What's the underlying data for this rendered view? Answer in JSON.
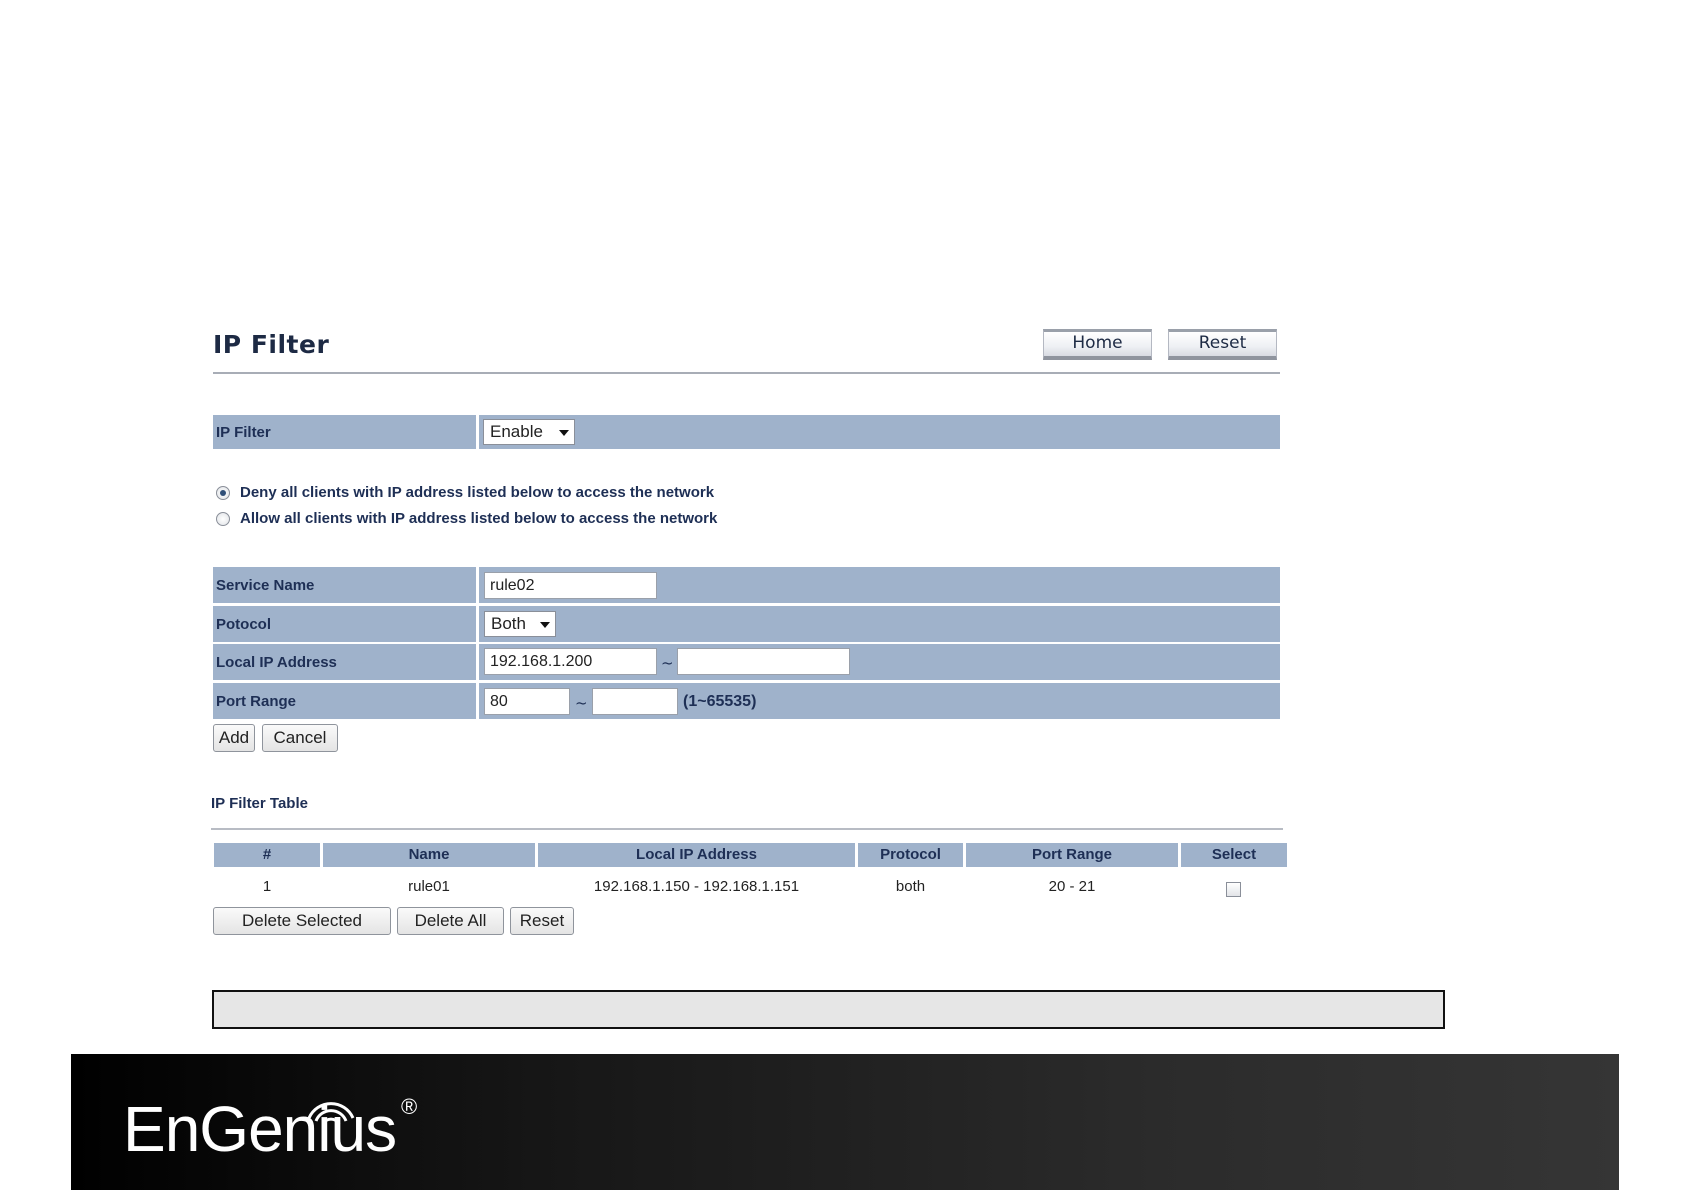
{
  "header": {
    "title": "IP Filter",
    "home_label": "Home",
    "reset_label": "Reset"
  },
  "ip_filter": {
    "label": "IP Filter",
    "value": "Enable"
  },
  "policy": {
    "deny_label": "Deny all clients with IP address listed below to access the network",
    "allow_label": "Allow all clients with IP address listed below to access the network",
    "selected": "deny"
  },
  "form": {
    "service_name_label": "Service Name",
    "service_name_value": "rule02",
    "protocol_label": "Potocol",
    "protocol_value": "Both",
    "local_ip_label": "Local IP Address",
    "local_ip_start": "192.168.1.200",
    "local_ip_end": "",
    "port_range_label": "Port Range",
    "port_start": "80",
    "port_end": "",
    "port_hint": "(1~65535)",
    "range_sep": "~",
    "add_label": "Add",
    "cancel_label": "Cancel"
  },
  "table": {
    "title": "IP Filter Table",
    "columns": [
      "#",
      "Name",
      "Local IP Address",
      "Protocol",
      "Port Range",
      "Select"
    ],
    "rows": [
      {
        "num": "1",
        "name": "rule01",
        "local_ip": "192.168.1.150 - 192.168.1.151",
        "protocol": "both",
        "port_range": "20 - 21",
        "selected": false
      }
    ],
    "delete_selected_label": "Delete Selected",
    "delete_all_label": "Delete All",
    "reset_label": "Reset"
  },
  "footer": {
    "logo_text": "EnGenius",
    "logo_mark": "®"
  },
  "colors": {
    "row_bg": "#9fb2cb",
    "label_text": "#1e2f55",
    "footer_bg": "#1a1a1a"
  }
}
